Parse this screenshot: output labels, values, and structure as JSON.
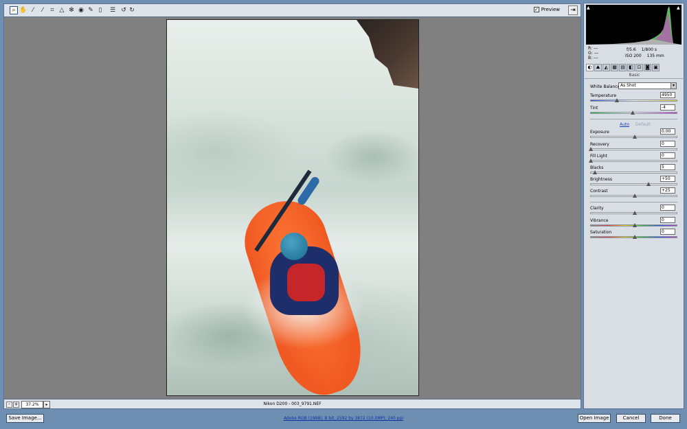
{
  "toolbar": {
    "tools": [
      "zoom-icon",
      "hand-icon",
      "eyedropper-icon",
      "color-sampler-icon",
      "crop-icon",
      "straighten-icon",
      "retouch-icon",
      "red-eye-icon",
      "brush-icon",
      "filter-icon",
      "preferences-icon",
      "rotate-left-icon",
      "rotate-right-icon"
    ],
    "tool_glyphs": [
      "⌕",
      "✋",
      "⁄",
      "⁄",
      "⌗",
      "△",
      "✻",
      "◉",
      "✎",
      "▯",
      "☰",
      "↺",
      "↻"
    ],
    "preview_check": "✓",
    "preview_label": "Preview",
    "fullscreen_glyph": "⇥"
  },
  "bottom": {
    "zoom_minus": "-",
    "zoom_plus": "+",
    "zoom_value": "37.2%",
    "zoom_arrow": "▸",
    "filename": "Nikon D200  -  003_9791.NEF"
  },
  "histogram": {
    "r": "R: ---",
    "g": "G: ---",
    "b": "B: ---",
    "aperture": "f/5.6",
    "shutter": "1/800 s",
    "iso": "ISO 200",
    "focal": "135 mm"
  },
  "panel": {
    "tabs": [
      "◐",
      "⛰",
      "◭",
      "▦",
      "▤",
      "◧",
      "⊡",
      "◙",
      "▣"
    ],
    "title": "Basic",
    "white_balance_label": "White Balance:",
    "white_balance_value": "As Shot",
    "wb_arrow": "▾",
    "auto": "Auto",
    "default": "Default",
    "controls": [
      {
        "label": "Temperature",
        "value": "4950",
        "pos": 0.3
      },
      {
        "label": "Tint",
        "value": "-4",
        "pos": 0.48
      },
      {
        "label": "Exposure",
        "value": "0.00",
        "pos": 0.5
      },
      {
        "label": "Recovery",
        "value": "0",
        "pos": 0.0
      },
      {
        "label": "Fill Light",
        "value": "0",
        "pos": 0.0
      },
      {
        "label": "Blacks",
        "value": "5",
        "pos": 0.05
      },
      {
        "label": "Brightness",
        "value": "+50",
        "pos": 0.66
      },
      {
        "label": "Contrast",
        "value": "+25",
        "pos": 0.5
      },
      {
        "label": "Clarity",
        "value": "0",
        "pos": 0.5
      },
      {
        "label": "Vibrance",
        "value": "0",
        "pos": 0.5
      },
      {
        "label": "Saturation",
        "value": "0",
        "pos": 0.5
      }
    ]
  },
  "footer": {
    "save": "Save Image...",
    "info": "Adobe RGB (1998); 8 bit; 2592 by 3872 (10.0MP); 240 ppi",
    "open": "Open Image",
    "cancel": "Cancel",
    "done": "Done"
  },
  "colors": {
    "frame": "#6f8fb2",
    "panel": "#d9dde4",
    "canvas": "#808080",
    "kayak": "#f05a22"
  }
}
